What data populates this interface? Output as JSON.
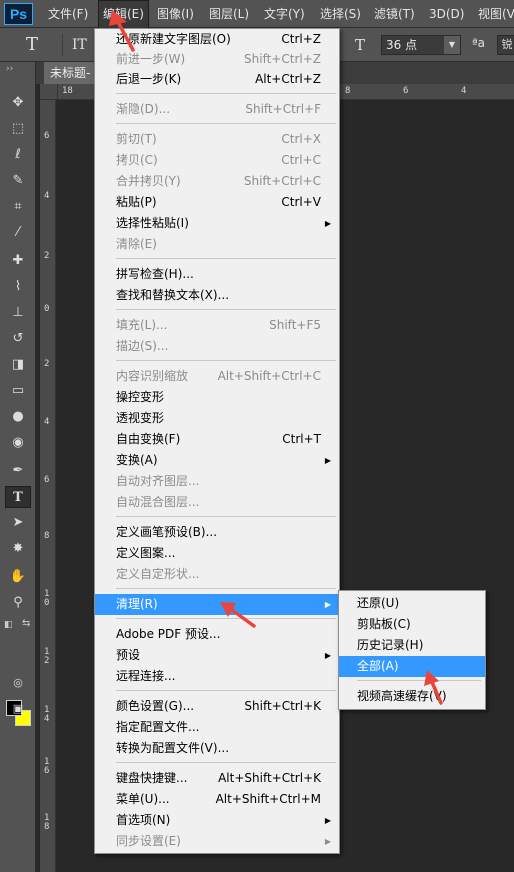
{
  "app": {
    "logo": "Ps"
  },
  "menubar": {
    "items": [
      "文件(F)",
      "编辑(E)",
      "图像(I)",
      "图层(L)",
      "文字(Y)",
      "选择(S)",
      "滤镜(T)",
      "3D(D)",
      "视图(V)"
    ],
    "active": "编辑(E)"
  },
  "options_bar": {
    "tool_glyph": "T",
    "orientation_glyph": "IT",
    "font_size_glyph": "T",
    "font_size": "36 点",
    "antialias": "ªa",
    "trailing_glyph": "锐"
  },
  "document": {
    "tab_title": "未标题-",
    "ruler_h": [
      "18",
      "8",
      "6",
      "4"
    ],
    "ruler_v": [
      "6",
      "4",
      "2",
      "0",
      "2",
      "4",
      "6",
      "8",
      "10",
      "12",
      "14",
      "16",
      "18"
    ]
  },
  "edit_menu": {
    "items": [
      {
        "label": "还原新建文字图层(O)",
        "shortcut": "Ctrl+Z",
        "disabled": false
      },
      {
        "label": "前进一步(W)",
        "shortcut": "Shift+Ctrl+Z",
        "disabled": true
      },
      {
        "label": "后退一步(K)",
        "shortcut": "Alt+Ctrl+Z",
        "disabled": false
      },
      {
        "label": "渐隐(D)...",
        "shortcut": "Shift+Ctrl+F",
        "disabled": true
      },
      {
        "label": "剪切(T)",
        "shortcut": "Ctrl+X",
        "disabled": true
      },
      {
        "label": "拷贝(C)",
        "shortcut": "Ctrl+C",
        "disabled": true
      },
      {
        "label": "合并拷贝(Y)",
        "shortcut": "Shift+Ctrl+C",
        "disabled": true
      },
      {
        "label": "粘贴(P)",
        "shortcut": "Ctrl+V",
        "disabled": false
      },
      {
        "label": "选择性粘贴(I)",
        "shortcut": "",
        "disabled": false,
        "submenu": true
      },
      {
        "label": "清除(E)",
        "shortcut": "",
        "disabled": true
      },
      {
        "label": "拼写检查(H)...",
        "shortcut": "",
        "disabled": false
      },
      {
        "label": "查找和替换文本(X)...",
        "shortcut": "",
        "disabled": false
      },
      {
        "label": "填充(L)...",
        "shortcut": "Shift+F5",
        "disabled": true
      },
      {
        "label": "描边(S)...",
        "shortcut": "",
        "disabled": true
      },
      {
        "label": "内容识别缩放",
        "shortcut": "Alt+Shift+Ctrl+C",
        "disabled": true
      },
      {
        "label": "操控变形",
        "shortcut": "",
        "disabled": false
      },
      {
        "label": "透视变形",
        "shortcut": "",
        "disabled": false
      },
      {
        "label": "自由变换(F)",
        "shortcut": "Ctrl+T",
        "disabled": false
      },
      {
        "label": "变换(A)",
        "shortcut": "",
        "disabled": false,
        "submenu": true
      },
      {
        "label": "自动对齐图层...",
        "shortcut": "",
        "disabled": true
      },
      {
        "label": "自动混合图层...",
        "shortcut": "",
        "disabled": true
      },
      {
        "label": "定义画笔预设(B)...",
        "shortcut": "",
        "disabled": false
      },
      {
        "label": "定义图案...",
        "shortcut": "",
        "disabled": false
      },
      {
        "label": "定义自定形状...",
        "shortcut": "",
        "disabled": true
      },
      {
        "label": "清理(R)",
        "shortcut": "",
        "disabled": false,
        "submenu": true,
        "highlighted": true
      },
      {
        "label": "Adobe PDF 预设...",
        "shortcut": "",
        "disabled": false
      },
      {
        "label": "预设",
        "shortcut": "",
        "disabled": false,
        "submenu": true
      },
      {
        "label": "远程连接...",
        "shortcut": "",
        "disabled": false
      },
      {
        "label": "颜色设置(G)...",
        "shortcut": "Shift+Ctrl+K",
        "disabled": false
      },
      {
        "label": "指定配置文件...",
        "shortcut": "",
        "disabled": false
      },
      {
        "label": "转换为配置文件(V)...",
        "shortcut": "",
        "disabled": false
      },
      {
        "label": "键盘快捷键...",
        "shortcut": "Alt+Shift+Ctrl+K",
        "disabled": false
      },
      {
        "label": "菜单(U)...",
        "shortcut": "Alt+Shift+Ctrl+M",
        "disabled": false
      },
      {
        "label": "首选项(N)",
        "shortcut": "",
        "disabled": false,
        "submenu": true
      },
      {
        "label": "同步设置(E)",
        "shortcut": "",
        "disabled": true,
        "submenu": true
      }
    ]
  },
  "purge_submenu": {
    "items": [
      {
        "label": "还原(U)",
        "highlighted": false
      },
      {
        "label": "剪贴板(C)",
        "highlighted": false
      },
      {
        "label": "历史记录(H)",
        "highlighted": false
      },
      {
        "label": "全部(A)",
        "highlighted": true
      },
      {
        "label": "视频高速缓存(V)",
        "highlighted": false
      }
    ]
  },
  "colors": {
    "menu_highlight": "#3399ff",
    "foreground_swatch": "#000000",
    "background_swatch": "#ffff00",
    "annotation_arrow": "#e8463a"
  },
  "toolbox_icons": [
    "move-icon",
    "marquee-icon",
    "lasso-icon",
    "quick-select-icon",
    "crop-icon",
    "eyedropper-icon",
    "healing-brush-icon",
    "brush-icon",
    "clone-stamp-icon",
    "history-brush-icon",
    "eraser-icon",
    "gradient-icon",
    "blur-icon",
    "dodge-icon",
    "pen-icon",
    "type-icon",
    "path-select-icon",
    "custom-shape-icon",
    "hand-icon",
    "zoom-icon"
  ]
}
